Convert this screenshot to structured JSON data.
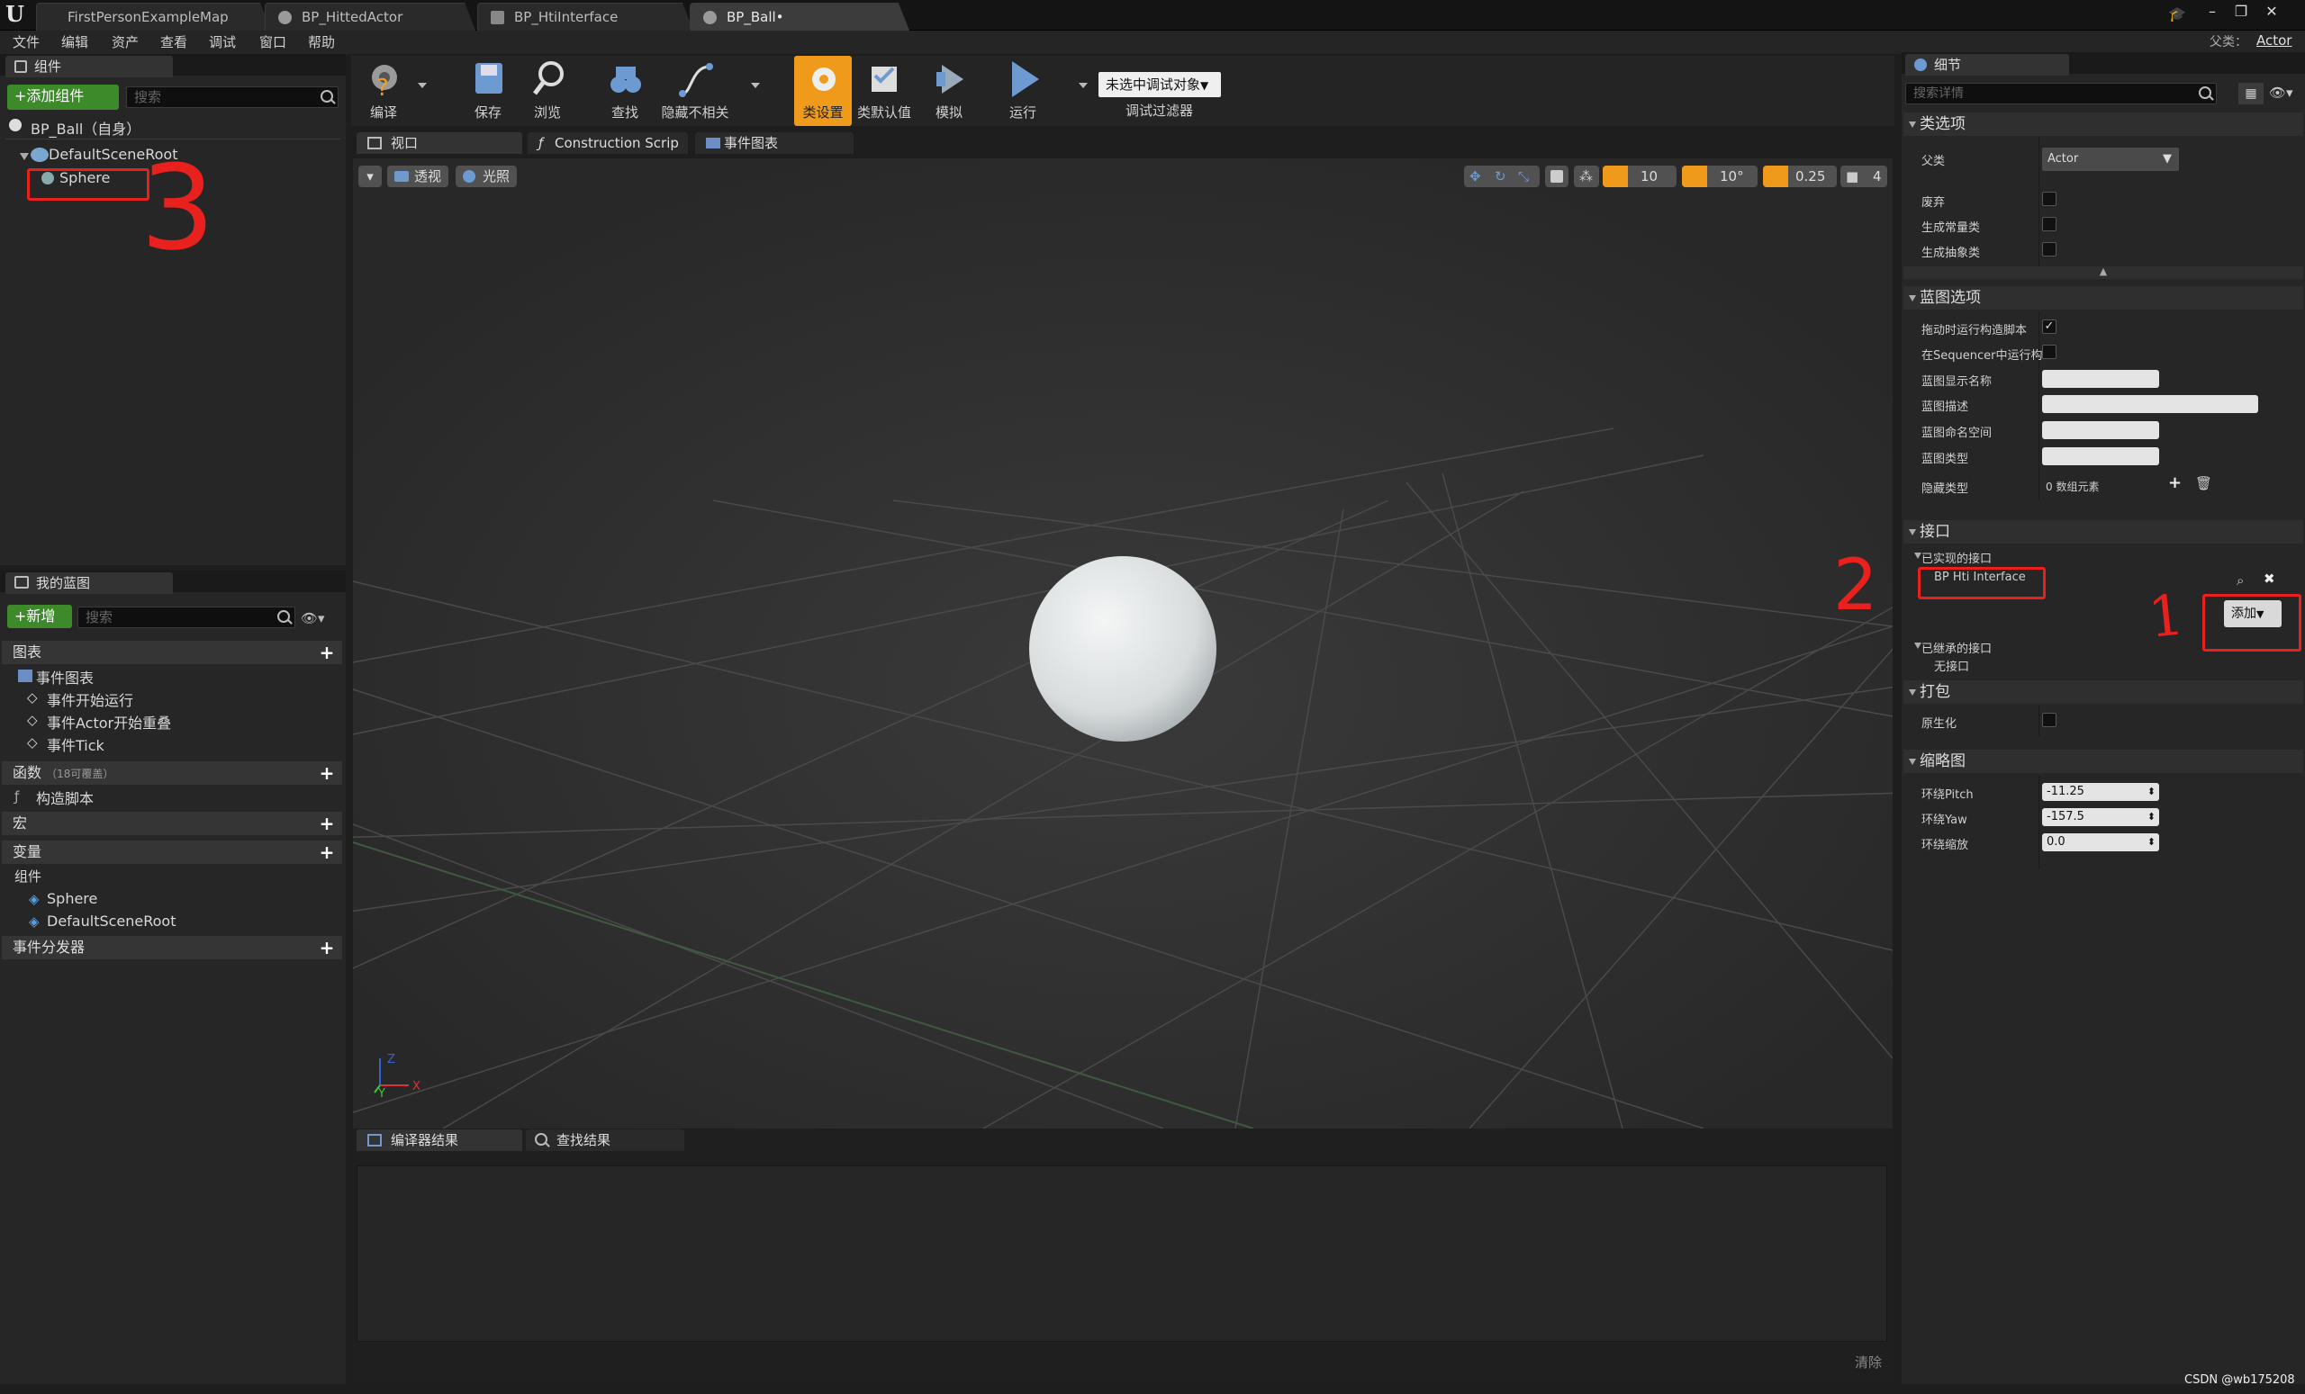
{
  "title_tabs": [
    {
      "label": "FirstPersonExampleMap"
    },
    {
      "label": "BP_HittedActor"
    },
    {
      "label": "BP_HtiInterface"
    },
    {
      "label": "BP_Ball•"
    }
  ],
  "parent_class_label": "父类：",
  "parent_class_value": "Actor",
  "menu": [
    "文件",
    "编辑",
    "资产",
    "查看",
    "调试",
    "窗口",
    "帮助"
  ],
  "components_panel": {
    "tab": "组件",
    "add_button": "+添加组件",
    "search_placeholder": "搜索",
    "root_label": "BP_Ball（自身）",
    "tree": [
      "DefaultSceneRoot",
      "Sphere"
    ]
  },
  "toolbar": {
    "buttons": [
      "编译",
      "保存",
      "浏览",
      "查找",
      "隐藏不相关",
      "类设置",
      "类默认值",
      "模拟",
      "运行"
    ],
    "debug_dropdown": "未选中调试对象",
    "debug_filter_label": "调试过滤器"
  },
  "editor_tabs": [
    "视口",
    "Construction Scrip",
    "事件图表"
  ],
  "viewport": {
    "perspective": "透视",
    "lit": "光照",
    "grid_value": "10",
    "rotation_value": "10°",
    "scale_value": "0.25",
    "camera_speed": "4",
    "axis_x": "X",
    "axis_y": "Y",
    "axis_z": "Z"
  },
  "my_blueprint": {
    "tab": "我的蓝图",
    "new_button": "+新增",
    "search_placeholder": "搜索",
    "graph_header": "图表",
    "event_graph": "事件图表",
    "events": [
      "事件开始运行",
      "事件Actor开始重叠",
      "事件Tick"
    ],
    "functions_header": "函数",
    "functions_override": "（18可覆盖）",
    "construction_script": "构造脚本",
    "macros_header": "宏",
    "variables_header": "变量",
    "components_header": "组件",
    "components": [
      "Sphere",
      "DefaultSceneRoot"
    ],
    "dispatchers_header": "事件分发器"
  },
  "bottom": {
    "tabs": [
      "编译器结果",
      "查找结果"
    ],
    "clear": "清除"
  },
  "details": {
    "tab": "细节",
    "search_placeholder": "搜索详情",
    "class_options": "类选项",
    "parent_class": "父类",
    "parent_class_value": "Actor",
    "deprecate": "废弃",
    "generate_const": "生成常量类",
    "generate_abstract": "生成抽象类",
    "blueprint_options": "蓝图选项",
    "run_construction_on_drag": "拖动时运行构造脚本",
    "run_in_sequencer": "在Sequencer中运行构",
    "bp_display_name": "蓝图显示名称",
    "bp_description": "蓝图描述",
    "bp_namespace": "蓝图命名空间",
    "bp_type": "蓝图类型",
    "hide_categories": "隐藏类型",
    "hide_categories_value": "0 数组元素",
    "interfaces": "接口",
    "implemented_interfaces": "已实现的接口",
    "interface_item": "BP Hti Interface",
    "add_button": "添加",
    "inherited_interfaces": "已继承的接口",
    "no_interface": "无接口",
    "packaging": "打包",
    "nativize": "原生化",
    "thumbnail": "缩略图",
    "orbit_pitch": "环绕Pitch",
    "orbit_pitch_value": "-11.25",
    "orbit_yaw": "环绕Yaw",
    "orbit_yaw_value": "-157.5",
    "orbit_zoom": "环绕缩放",
    "orbit_zoom_value": "0.0"
  },
  "annotations": [
    "1",
    "2",
    "3"
  ],
  "watermark": "CSDN @wb175208",
  "colors": {
    "accent_orange": "#f09a1b",
    "add_green": "#3d8a2b",
    "annotation_red": "#e8201e"
  }
}
